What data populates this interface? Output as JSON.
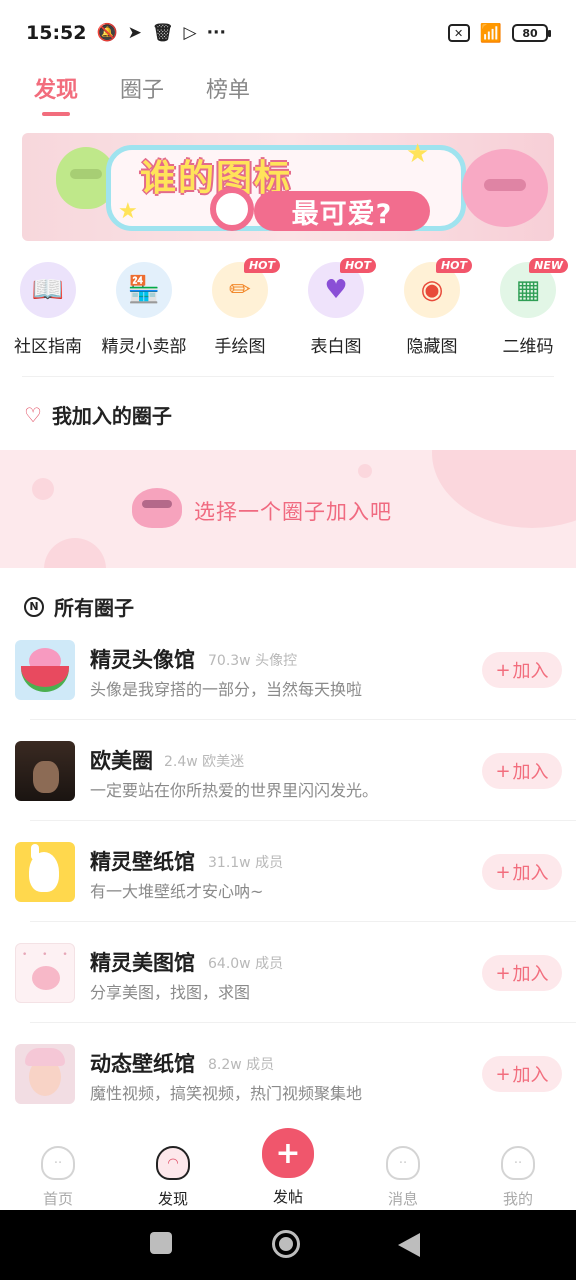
{
  "status_bar": {
    "time": "15:52",
    "left_icons": [
      "bell-muted-icon",
      "telegram-icon",
      "trash-icon",
      "play-icon",
      "more-icon"
    ],
    "more": "···",
    "battery": "80"
  },
  "top_tabs": [
    {
      "label": "发现",
      "active": true
    },
    {
      "label": "圈子",
      "active": false
    },
    {
      "label": "榜单",
      "active": false
    }
  ],
  "banner": {
    "line1": "谁的图标",
    "line2": "最可爱?"
  },
  "quick_links": [
    {
      "label": "社区指南",
      "icon": "guide-book-icon",
      "badge": "",
      "bg": "#ece3fb",
      "glyph": "📖"
    },
    {
      "label": "精灵小卖部",
      "icon": "shop-icon",
      "badge": "",
      "bg": "#e3f0fb",
      "glyph": "🏪"
    },
    {
      "label": "手绘图",
      "icon": "pencil-icon",
      "badge": "HOT",
      "bg": "#fff1d6",
      "glyph": "✏"
    },
    {
      "label": "表白图",
      "icon": "heart-card-icon",
      "badge": "HOT",
      "bg": "#efe3fb",
      "glyph": "♥"
    },
    {
      "label": "隐藏图",
      "icon": "eye-icon",
      "badge": "HOT",
      "bg": "#fff1d6",
      "glyph": "◉"
    },
    {
      "label": "二维码",
      "icon": "qr-code-icon",
      "badge": "NEW",
      "bg": "#e2f6e6",
      "glyph": "▦"
    }
  ],
  "my_circles": {
    "title": "我加入的圈子",
    "empty_prompt": "选择一个圈子加入吧"
  },
  "all_circles": {
    "title": "所有圈子",
    "join_label": "加入",
    "items": [
      {
        "name": "精灵头像馆",
        "count": "70.3w",
        "member_label": "头像控",
        "desc": "头像是我穿搭的一部分，当然每天换啦"
      },
      {
        "name": "欧美圈",
        "count": "2.4w",
        "member_label": "欧美迷",
        "desc": "一定要站在你所热爱的世界里闪闪发光。"
      },
      {
        "name": "精灵壁纸馆",
        "count": "31.1w",
        "member_label": "成员",
        "desc": "有一大堆壁纸才安心呐~"
      },
      {
        "name": "精灵美图馆",
        "count": "64.0w",
        "member_label": "成员",
        "desc": "分享美图，找图，求图"
      },
      {
        "name": "动态壁纸馆",
        "count": "8.2w",
        "member_label": "成员",
        "desc": "魔性视频，搞笑视频，热门视频聚集地"
      }
    ]
  },
  "bottom_nav": [
    {
      "label": "首页",
      "icon": "home-mascot-icon"
    },
    {
      "label": "发现",
      "icon": "discover-planet-icon",
      "active": true
    },
    {
      "label": "发帖",
      "icon": "plus-icon"
    },
    {
      "label": "消息",
      "icon": "message-bubble-icon"
    },
    {
      "label": "我的",
      "icon": "profile-mascot-icon"
    }
  ],
  "colors": {
    "accent": "#f26d7d",
    "join_bg": "#fde8eb",
    "promo_bg": "#fde9ec"
  }
}
